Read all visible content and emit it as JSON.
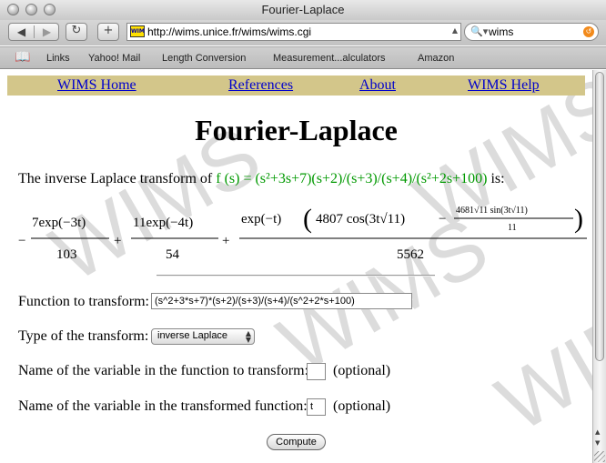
{
  "window": {
    "title": "Fourier-Laplace"
  },
  "toolbar": {
    "back_glyph": "◀",
    "forward_glyph": "▶",
    "reload_glyph": "↻",
    "add_glyph": "+",
    "url": "http://wims.unice.fr/wims/wims.cgi",
    "favicon_text": "WIMS",
    "search_value": "wims"
  },
  "bookmarks": [
    "Links",
    "Yahoo! Mail",
    "Length Conversion",
    "Measurement...alculators",
    "Amazon"
  ],
  "nav": {
    "home": "WIMS Home",
    "references": "References",
    "about": "About",
    "help": "WIMS Help"
  },
  "page": {
    "title": "Fourier-Laplace",
    "intro_prefix": "The inverse Laplace transform of",
    "function_display": "f (s) = (s²+3s+7)(s+2)/(s+3)/(s+4)/(s²+2s+100)",
    "intro_suffix": "is:",
    "watermark": "WIMS"
  },
  "result": {
    "t1_num": "7exp(−3t)",
    "t1_den": "103",
    "t2_num": "11exp(−4t)",
    "t2_den": "54",
    "t3_num_a": "exp(−t)",
    "t3_num_b": "4807 cos(3t√11)",
    "t3_num_c_num": "4681√11 sin(3t√11)",
    "t3_num_c_den": "11",
    "t3_den": "5562"
  },
  "form": {
    "function_label": "Function to transform:",
    "function_value": "(s^2+3*s+7)*(s+2)/(s+3)/(s+4)/(s^2+2*s+100)",
    "type_label": "Type of the transform:",
    "type_value": "inverse Laplace",
    "var_in_label": "Name of the variable in the function to transform:",
    "var_in_value": "",
    "var_out_label": "Name of the variable in the transformed function:",
    "var_out_value": "t",
    "optional": "(optional)",
    "compute_label": "Compute"
  }
}
